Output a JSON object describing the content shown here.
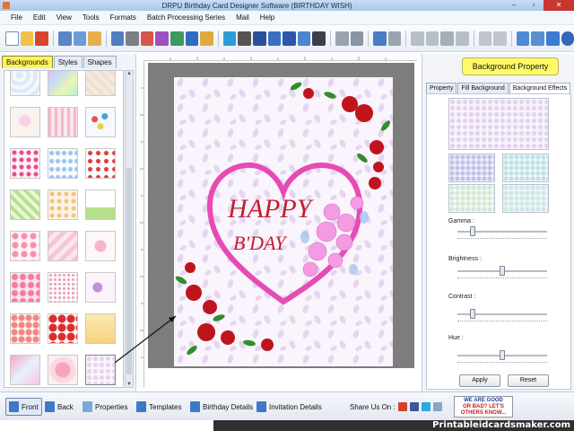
{
  "window": {
    "title": "DRPU Birthday Card Designer Software (BIRTHDAY WISH)",
    "minimize": "–",
    "maximize": "▫",
    "close": "✕"
  },
  "menu": [
    "File",
    "Edit",
    "View",
    "Tools",
    "Formats",
    "Batch Processing Series",
    "Mail",
    "Help"
  ],
  "left_panel": {
    "tabs": [
      "Backgrounds",
      "Styles",
      "Shapes"
    ],
    "active_tab": "Backgrounds"
  },
  "card": {
    "line1": "HAPPY",
    "line2": "B'DAY"
  },
  "right_panel": {
    "header": "Background Property",
    "tabs": [
      "Property",
      "Fill Background",
      "Background Effects"
    ],
    "active_tab": "Background Effects",
    "sliders": [
      {
        "label": "Gamma :",
        "value": 0.15
      },
      {
        "label": "Brightness :",
        "value": 0.5
      },
      {
        "label": "Contrast :",
        "value": 0.15
      },
      {
        "label": "Hue :",
        "value": 0.5
      }
    ],
    "apply_label": "Apply",
    "reset_label": "Reset"
  },
  "bottom_bar": {
    "items": [
      "Front",
      "Back",
      "Properties",
      "Templates",
      "Birthday Details",
      "Invitation Details"
    ],
    "active": "Front",
    "share_label": "Share Us On :",
    "feedback_line1": "WE ARE GOOD",
    "feedback_line2": "OR BAD? LET'S",
    "feedback_line3": "OTHERS KNOW..."
  },
  "watermark": "Printableidcardsmaker.com",
  "colors": {
    "active_tab_yellow": "#fff45a",
    "heart_pink": "#e64bb5",
    "happy_red": "#c11f32",
    "rose_red": "#c0141c",
    "close_red": "#c8372d"
  }
}
